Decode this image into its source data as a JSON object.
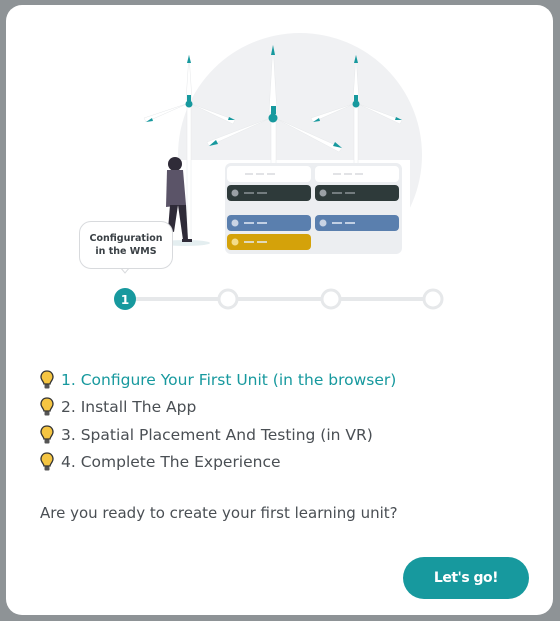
{
  "illustration": {
    "bubble_line1": "Configuration",
    "bubble_line2": "in the WMS",
    "current_step": "1",
    "total_steps": 4
  },
  "steps": [
    {
      "label": "1. Configure Your First Unit (in the browser)",
      "active": true
    },
    {
      "label": "2. Install The App",
      "active": false
    },
    {
      "label": "3. Spatial Placement And Testing (in VR)",
      "active": false
    },
    {
      "label": "4. Complete The Experience",
      "active": false
    }
  ],
  "question": "Are you ready to create your first learning unit?",
  "button": {
    "label": "Let's go!"
  },
  "colors": {
    "accent": "#17999e",
    "bulb": "#f5c542",
    "dark_bar": "#2e3a3a",
    "blue_bar": "#5a7fae",
    "yellow_bar": "#d4a20a"
  }
}
